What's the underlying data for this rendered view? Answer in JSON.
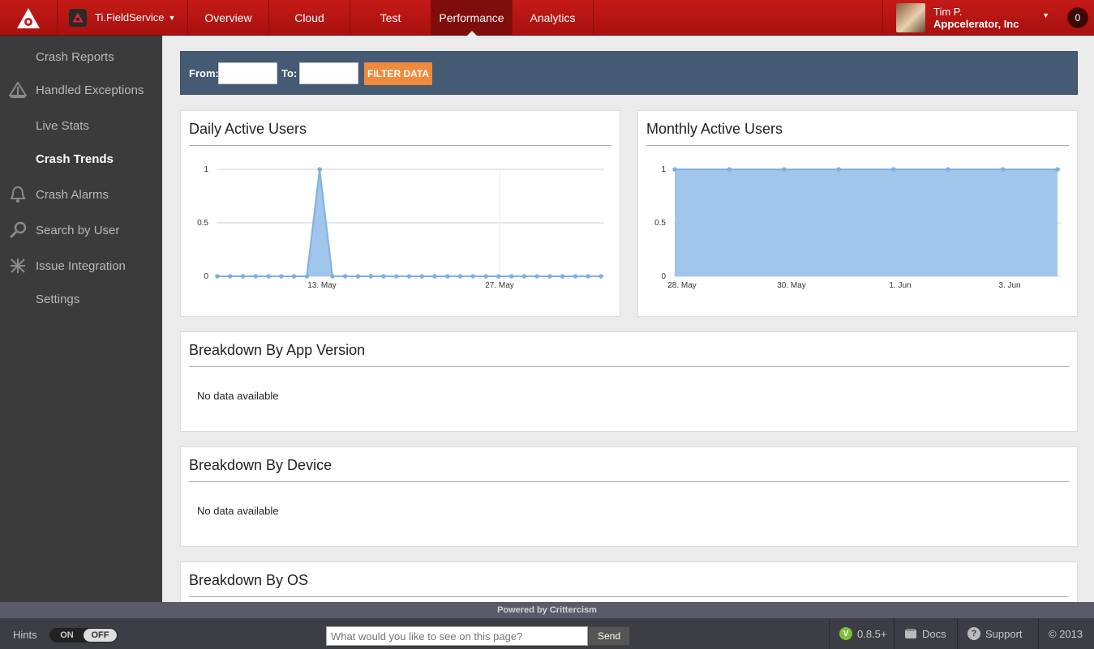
{
  "header": {
    "app_name": "Ti.FieldService",
    "nav": [
      {
        "label": "Overview"
      },
      {
        "label": "Cloud"
      },
      {
        "label": "Test"
      },
      {
        "label": "Performance",
        "active": true
      },
      {
        "label": "Analytics"
      }
    ],
    "user": {
      "name": "Tim P.",
      "org": "Appcelerator, Inc"
    },
    "notification_count": "0"
  },
  "sidebar": {
    "items": [
      {
        "label": "Crash Reports",
        "icon": ""
      },
      {
        "label": "Handled Exceptions",
        "icon": "shield-icon"
      },
      {
        "label": "Live Stats",
        "icon": ""
      },
      {
        "label": "Crash Trends",
        "icon": "",
        "active": true
      },
      {
        "label": "Crash Alarms",
        "icon": "bell-icon"
      },
      {
        "label": "Search by User",
        "icon": "magnifier-icon"
      },
      {
        "label": "Issue Integration",
        "icon": "puzzle-icon"
      },
      {
        "label": "Settings",
        "icon": ""
      }
    ]
  },
  "filter": {
    "from_label": "From:",
    "to_label": "To:",
    "from_value": "",
    "to_value": "",
    "button_label": "FILTER DATA"
  },
  "panels": {
    "dau_title": "Daily Active Users",
    "mau_title": "Monthly Active Users",
    "app_version_title": "Breakdown By App Version",
    "app_version_empty": "No data available",
    "device_title": "Breakdown By Device",
    "device_empty": "No data available",
    "os_title": "Breakdown By OS"
  },
  "chart_data": [
    {
      "type": "area",
      "title": "Daily Active Users",
      "x_tick_labels": [
        "13. May",
        "27. May"
      ],
      "y_tick_labels": [
        "0",
        "0.5",
        "1"
      ],
      "ylim": [
        0,
        1
      ],
      "series": [
        {
          "values": [
            0,
            0,
            0,
            0,
            0,
            0,
            0,
            0,
            1,
            0,
            0,
            0,
            0,
            0,
            0,
            0,
            0,
            0,
            0,
            0,
            0,
            0,
            0,
            0,
            0,
            0,
            0,
            0,
            0,
            0,
            0
          ]
        }
      ],
      "color": "#9cc3ea"
    },
    {
      "type": "area",
      "title": "Monthly Active Users",
      "x_tick_labels": [
        "28. May",
        "30. May",
        "1. Jun",
        "3. Jun"
      ],
      "y_tick_labels": [
        "0",
        "0.5",
        "1"
      ],
      "ylim": [
        0,
        1
      ],
      "series": [
        {
          "values": [
            1,
            1,
            1,
            1,
            1,
            1,
            1,
            1
          ]
        }
      ],
      "color": "#9cc3ea"
    }
  ],
  "footer": {
    "powered": "Powered by Crittercism",
    "hints_label": "Hints",
    "toggle_on": "ON",
    "toggle_off": "OFF",
    "ask_placeholder": "What would you like to see on this page?",
    "send_label": "Send",
    "version": "0.8.5+",
    "version_badge": "V",
    "docs_label": "Docs",
    "support_label": "Support",
    "copyright": "© 2013"
  }
}
